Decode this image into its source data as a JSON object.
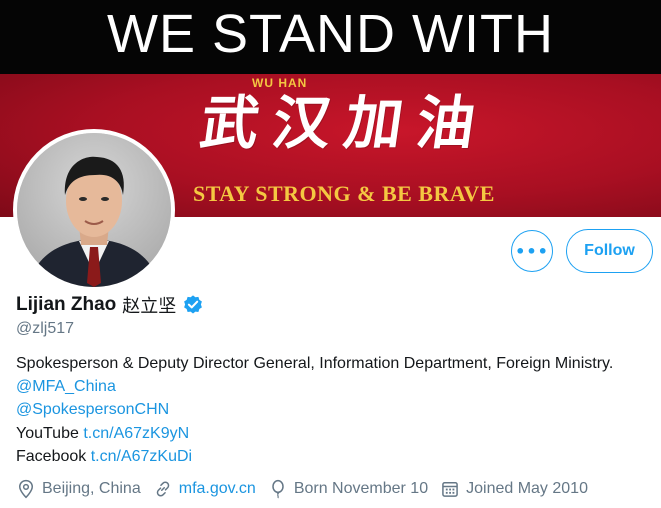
{
  "banner": {
    "headline": "WE STAND WITH",
    "sub_label": "WU HAN",
    "calligraphy": "武汉加油",
    "slogan": "STAY STRONG & BE BRAVE"
  },
  "actions": {
    "more_label": "•••",
    "follow_label": "Follow"
  },
  "profile": {
    "name": "Lijian Zhao",
    "name_cn": "赵立坚",
    "handle": "@zlj517",
    "bio": {
      "line1": "Spokesperson & Deputy Director General, Information Department, Foreign Ministry.",
      "mention1": "@MFA_China",
      "mention2": "@SpokespersonCHN",
      "youtube_label": "YouTube",
      "youtube_link": "t.cn/A67zK9yN",
      "facebook_label": "Facebook",
      "facebook_link": "t.cn/A67zKuDi"
    },
    "location": "Beijing, China",
    "website": "mfa.gov.cn",
    "born": "Born November 10",
    "joined": "Joined May 2010"
  },
  "colors": {
    "accent": "#1da1f2",
    "link": "#1b95e0",
    "secondary_text": "#657786",
    "banner_red": "#b8142a",
    "banner_gold": "#f4c842"
  },
  "icons": [
    "location-icon",
    "link-icon",
    "balloon-icon",
    "calendar-icon",
    "verified-badge-icon"
  ]
}
